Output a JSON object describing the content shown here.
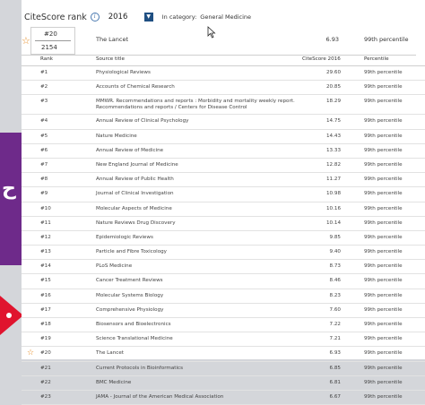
{
  "header": {
    "title": "CiteScore rank",
    "info_icon": "info-icon",
    "year": "2016",
    "category_label": "In category:",
    "category_value": "General Medicine"
  },
  "current": {
    "rank": "#20",
    "total": "2154",
    "title": "The Lancet",
    "score": "6.93",
    "percentile": "99th percentile"
  },
  "table": {
    "columns": [
      "Rank",
      "Source title",
      "CiteScore 2016",
      "Percentile"
    ],
    "rows": [
      {
        "rank": "#1",
        "title": "Physiological Reviews",
        "score": "29.60",
        "percentile": "99th percentile"
      },
      {
        "rank": "#2",
        "title": "Accounts of Chemical Research",
        "score": "20.85",
        "percentile": "99th percentile"
      },
      {
        "rank": "#3",
        "title": "MMWR. Recommendations and reports : Morbidity and mortality weekly report. Recommendations and reports / Centers for Disease Control",
        "score": "18.29",
        "percentile": "99th percentile"
      },
      {
        "rank": "#4",
        "title": "Annual Review of Clinical Psychology",
        "score": "14.75",
        "percentile": "99th percentile"
      },
      {
        "rank": "#5",
        "title": "Nature Medicine",
        "score": "14.43",
        "percentile": "99th percentile"
      },
      {
        "rank": "#6",
        "title": "Annual Review of Medicine",
        "score": "13.33",
        "percentile": "99th percentile"
      },
      {
        "rank": "#7",
        "title": "New England Journal of Medicine",
        "score": "12.82",
        "percentile": "99th percentile"
      },
      {
        "rank": "#8",
        "title": "Annual Review of Public Health",
        "score": "11.27",
        "percentile": "99th percentile"
      },
      {
        "rank": "#9",
        "title": "Journal of Clinical Investigation",
        "score": "10.98",
        "percentile": "99th percentile"
      },
      {
        "rank": "#10",
        "title": "Molecular Aspects of Medicine",
        "score": "10.16",
        "percentile": "99th percentile"
      },
      {
        "rank": "#11",
        "title": "Nature Reviews Drug Discovery",
        "score": "10.14",
        "percentile": "99th percentile"
      },
      {
        "rank": "#12",
        "title": "Epidemiologic Reviews",
        "score": "9.85",
        "percentile": "99th percentile"
      },
      {
        "rank": "#13",
        "title": "Particle and Fibre Toxicology",
        "score": "9.40",
        "percentile": "99th percentile"
      },
      {
        "rank": "#14",
        "title": "PLoS Medicine",
        "score": "8.73",
        "percentile": "99th percentile"
      },
      {
        "rank": "#15",
        "title": "Cancer Treatment Reviews",
        "score": "8.46",
        "percentile": "99th percentile"
      },
      {
        "rank": "#16",
        "title": "Molecular Systems Biology",
        "score": "8.23",
        "percentile": "99th percentile"
      },
      {
        "rank": "#17",
        "title": "Comprehensive Physiology",
        "score": "7.60",
        "percentile": "99th percentile"
      },
      {
        "rank": "#18",
        "title": "Biosensors and Bioelectronics",
        "score": "7.22",
        "percentile": "99th percentile"
      },
      {
        "rank": "#19",
        "title": "Science Translational Medicine",
        "score": "7.21",
        "percentile": "99th percentile"
      },
      {
        "rank": "#20",
        "title": "The Lancet",
        "score": "6.93",
        "percentile": "99th percentile",
        "starred": true
      },
      {
        "rank": "#21",
        "title": "Current Protocols in Bioinformatics",
        "score": "6.85",
        "percentile": "99th percentile"
      },
      {
        "rank": "#22",
        "title": "BMC Medicine",
        "score": "6.81",
        "percentile": "99th percentile"
      },
      {
        "rank": "#23",
        "title": "JAMA - Journal of the American Medical Association",
        "score": "6.67",
        "percentile": "99th percentile"
      }
    ]
  },
  "icons": {
    "star": "star-icon",
    "dropdown": "chevron-down-icon",
    "cursor": "mouse-pointer-icon"
  },
  "colors": {
    "star": "#e58a21",
    "select_button": "#1f4f82",
    "background_purple": "#6e2a8a",
    "background_red": "#e0142e"
  }
}
